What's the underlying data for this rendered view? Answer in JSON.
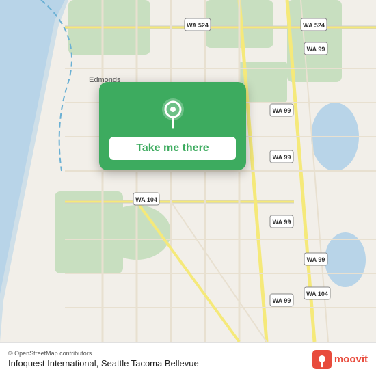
{
  "map": {
    "background_color": "#f2efe9",
    "water_color": "#b8d4e8",
    "green_color": "#c8dfc0"
  },
  "card": {
    "background_color": "#3dab5f",
    "button_label": "Take me there",
    "pin_icon": "map-pin"
  },
  "bottom_bar": {
    "attribution": "© OpenStreetMap contributors",
    "location_name": "Infoquest International, Seattle Tacoma Bellevue",
    "moovit_label": "moovit"
  }
}
